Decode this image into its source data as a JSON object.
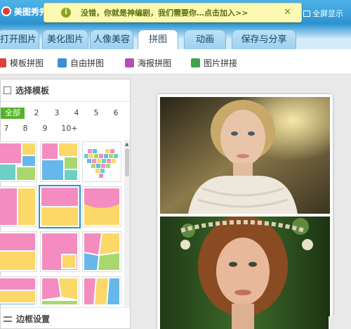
{
  "app": {
    "title": "美图秀秀",
    "fullscreen_label": "全屏显示",
    "notice": "没错，你就是神编剧，我们需要你…点击加入>>",
    "notice_close": "✕"
  },
  "nav": {
    "tabs": [
      {
        "label": "打开图片"
      },
      {
        "label": "美化图片"
      },
      {
        "label": "人像美容"
      },
      {
        "label": "拼图",
        "active": true
      },
      {
        "label": "动画"
      },
      {
        "label": "保存与分享"
      }
    ]
  },
  "subbar": {
    "items": [
      {
        "label": "模板拼图",
        "icon": "template-collage-icon",
        "color": "#d9443a"
      },
      {
        "label": "自由拼图",
        "icon": "free-collage-icon",
        "color": "#3a8fd6"
      },
      {
        "label": "海报拼图",
        "icon": "poster-collage-icon",
        "color": "#b44fb5"
      },
      {
        "label": "图片拼接",
        "icon": "image-stitch-icon",
        "color": "#3fa34a"
      }
    ]
  },
  "panel": {
    "title": "选择模板",
    "footer_title": "边框设置",
    "filters": [
      "全部",
      "2",
      "3",
      "4",
      "5",
      "6",
      "7",
      "8",
      "9",
      "10+"
    ],
    "selected_filter": "全部"
  },
  "colors": {
    "pink": "#f48cc0",
    "yellow": "#fbd868",
    "teal": "#6dcfc6",
    "green": "#a9d86e",
    "blue": "#66b8ea",
    "accent": "#2e8fd4",
    "filter_green": "#52b52a"
  }
}
